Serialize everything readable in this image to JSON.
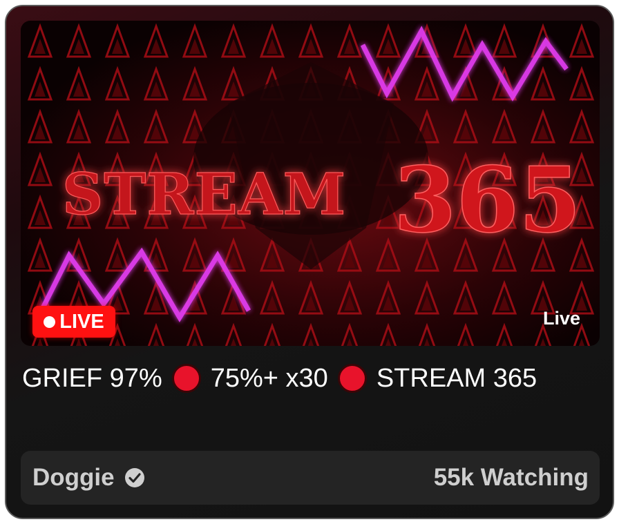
{
  "stream": {
    "thumbnail_text": {
      "word": "STREAM",
      "number": "365"
    },
    "live_badge": "LIVE",
    "live_tag": "Live",
    "title_parts": [
      "GRIEF 97%",
      "75%+ x30",
      "STREAM 365"
    ],
    "title_separator_icon": "red-circle-emoji"
  },
  "footer": {
    "creator": "Doggie",
    "verified_icon": "verified-check-icon",
    "viewers": "55k Watching"
  },
  "colors": {
    "live_badge": "#ff1111",
    "title_separator": "#e8132b",
    "footer_bg": "#242424"
  }
}
